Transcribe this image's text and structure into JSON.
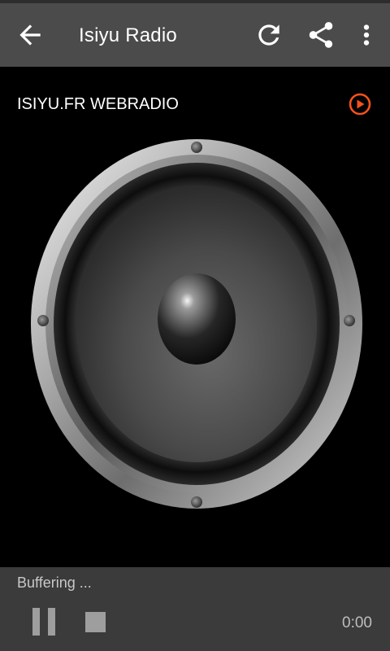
{
  "app_bar": {
    "title": "Isiyu Radio",
    "icons": [
      "arrow-back-icon",
      "refresh-icon",
      "share-icon",
      "more-vert-icon"
    ]
  },
  "station": {
    "name": "ISIYU.FR WEBRADIO",
    "play_icon": "play-circle-icon",
    "accent": "#f4511e"
  },
  "artwork": {
    "icon": "speaker-image"
  },
  "player": {
    "status": "Buffering ...",
    "time": "0:00",
    "controls": [
      "pause-icon",
      "stop-icon"
    ]
  },
  "colors": {
    "toolbar": "#4b4b4b",
    "player_bar": "#3b3b3b",
    "background": "#000000"
  }
}
